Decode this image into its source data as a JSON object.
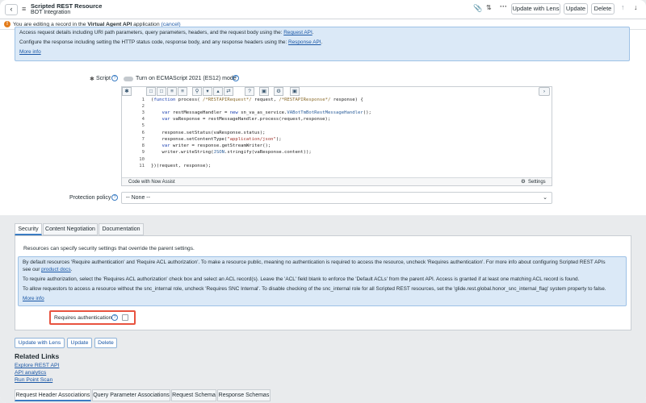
{
  "header": {
    "title": "Scripted REST Resource",
    "subtitle": "BOT Integration",
    "update_with_lens": "Update with Lens",
    "update": "Update",
    "delete": "Delete"
  },
  "notice": {
    "prefix": "You are editing a record in the",
    "app_name": "Virtual Agent API",
    "suffix": "application",
    "cancel": "(cancel)"
  },
  "top_info": {
    "line1": "Access request details including URI path parameters, query parameters, headers, and the request body using the:",
    "line1_link": "Request API",
    "line2": "Configure the response including setting the HTTP status code, response body, and any response headers using the:",
    "line2_link": "Response API",
    "more": "More info"
  },
  "script": {
    "label": "Script",
    "toggle_label": "Turn on ECMAScript 2021 (ES12) mode",
    "footer_left": "Code with Now Assist",
    "footer_right": "Settings",
    "line_numbers": [
      "1",
      "2",
      "3",
      "4",
      "5",
      "6",
      "7",
      "8",
      "9",
      "10",
      "11"
    ]
  },
  "protection": {
    "label": "Protection policy",
    "value": "-- None --"
  },
  "tabs": {
    "security": "Security",
    "content_negotiation": "Content Negotiation",
    "documentation": "Documentation"
  },
  "security": {
    "intro": "Resources can specify security settings that override the parent settings.",
    "p1": "By default resources 'Require authentication' and 'Require ACL authorization'. To make a resource public, meaning no authentication is required to access the resource, uncheck 'Requires authentication'. For more info about configuring Scripted REST APIs",
    "p1b": "see our",
    "p1_link": "product docs",
    "p2": "To require authorization, select the 'Requires ACL authorization' check box and select an ACL record(s). Leave the 'ACL' field blank to enforce the 'Default ACLs' from the parent API. Access is granted if at least one matching ACL record is found.",
    "p3": "To allow requestors to access a resource without the snc_internal role, uncheck 'Requires SNC Internal'. To disable checking of the snc_internal role for all Scripted REST resources, set the 'glide.rest.global.honor_snc_internal_flag' system property to false.",
    "more": "More info",
    "requires_auth": "Requires authentication"
  },
  "bottom_buttons": {
    "update_with_lens": "Update with Lens",
    "update": "Update",
    "delete": "Delete"
  },
  "related": {
    "title": "Related Links",
    "links": [
      "Explore REST API",
      "API analytics",
      "Run Point Scan"
    ]
  },
  "related_tabs": [
    "Request Header Associations",
    "Query Parameter Associations",
    "Request Schema",
    "Response Schemas"
  ]
}
